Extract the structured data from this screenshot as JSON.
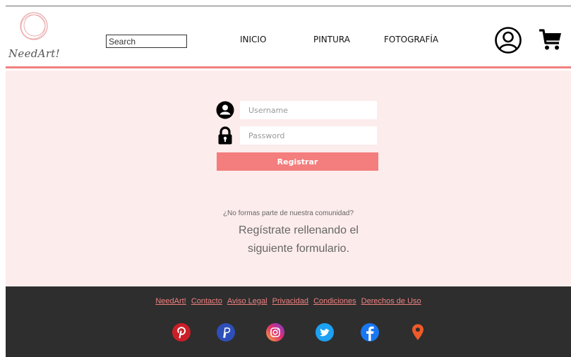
{
  "header": {
    "logo_text": "NeedArt!",
    "search_placeholder": "Search",
    "nav": {
      "inicio": "INICIO",
      "pintura": "PINTURA",
      "fotografia": "FOTOGRAFÍA"
    },
    "icons": {
      "account": "user-circle-icon",
      "cart": "shopping-cart-icon"
    }
  },
  "login": {
    "username_placeholder": "Username",
    "password_placeholder": "Password",
    "submit_label": "Registrar",
    "icons": {
      "username": "user-icon",
      "password": "lock-icon"
    }
  },
  "signup": {
    "question": "¿No formas parte de nuestra comunidad?",
    "cta": "Regístrate rellenando el siguiente formulario."
  },
  "footer": {
    "links": [
      "NeedArt!",
      "Contacto",
      "Aviso Legal",
      "Privacidad",
      "Condiciones",
      "Derechos de Uso"
    ],
    "social": [
      "pinterest-icon",
      "paypal-icon",
      "instagram-icon",
      "twitter-icon",
      "facebook-icon",
      "location-pin-icon"
    ]
  },
  "colors": {
    "accent": "#f08080",
    "button": "#f47d7d",
    "main_bg": "#fdecec",
    "footer_bg": "#2e2e2e"
  }
}
